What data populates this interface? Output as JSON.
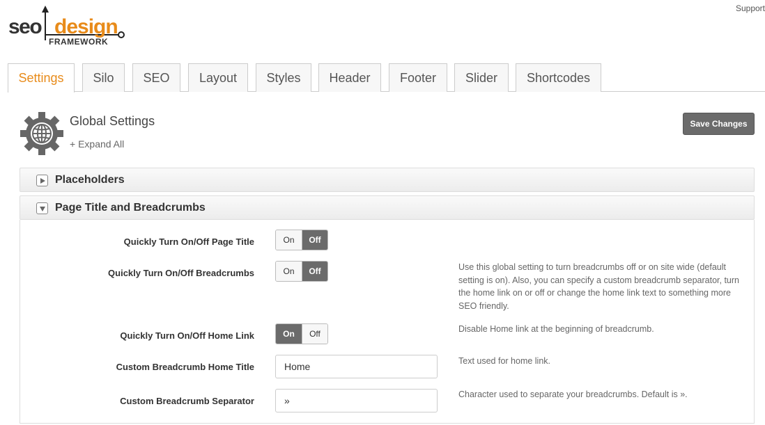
{
  "logo": {
    "seo": "seo",
    "design": "design",
    "framework": "FRAMEWORK"
  },
  "header": {
    "support": "Support"
  },
  "tabs": [
    "Settings",
    "Silo",
    "SEO",
    "Layout",
    "Styles",
    "Header",
    "Footer",
    "Slider",
    "Shortcodes"
  ],
  "active_tab": "Settings",
  "page": {
    "title": "Global Settings",
    "expand_all": "+ Expand All",
    "save": "Save Changes"
  },
  "panels": {
    "placeholders": "Placeholders",
    "breadcrumbs": "Page Title and Breadcrumbs"
  },
  "toggle": {
    "on": "On",
    "off": "Off"
  },
  "settings": {
    "page_title": {
      "label": "Quickly Turn On/Off Page Title",
      "value": "Off"
    },
    "breadcrumbs": {
      "label": "Quickly Turn On/Off Breadcrumbs",
      "value": "Off",
      "help": "Use this global setting to turn breadcrumbs off or on site wide (default setting is on). Also, you can specify a custom breadcrumb separator, turn the home link on or off or change the home link text to something more SEO friendly."
    },
    "home_link": {
      "label": "Quickly Turn On/Off Home Link",
      "value": "On",
      "help": "Disable Home link at the beginning of breadcrumb."
    },
    "home_title": {
      "label": "Custom Breadcrumb Home Title",
      "value": "Home",
      "help": "Text used for home link."
    },
    "separator": {
      "label": "Custom Breadcrumb Separator",
      "value": "»",
      "help": "Character used to separate your breadcrumbs. Default is »."
    }
  },
  "colors": {
    "accent": "#e88b1a",
    "dark": "#6b6b6b"
  }
}
